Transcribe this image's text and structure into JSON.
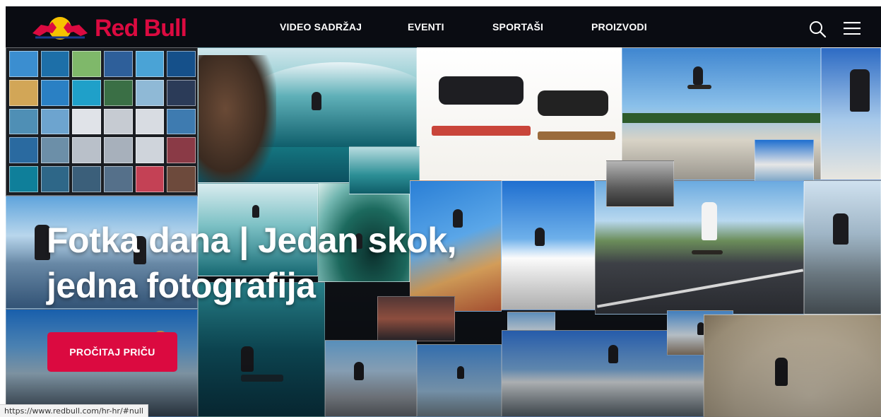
{
  "brand": {
    "name": "Red Bull",
    "accent_color": "#db0a40",
    "logo_icon": "red-bull-logo-icon"
  },
  "nav": {
    "links": [
      {
        "label": "VIDEO SADRŽAJ"
      },
      {
        "label": "EVENTI"
      },
      {
        "label": "SPORTAŠI"
      },
      {
        "label": "PROIZVODI"
      }
    ],
    "search_icon": "search-icon",
    "menu_icon": "hamburger-menu-icon"
  },
  "hero": {
    "headline_line1": "Fotka dana | Jedan skok,",
    "headline_line2": "jedna fotografija",
    "cta_label": "PROČITAJ PRIČU"
  },
  "status_bar": {
    "url": "https://www.redbull.com/hr-hr/#null"
  }
}
